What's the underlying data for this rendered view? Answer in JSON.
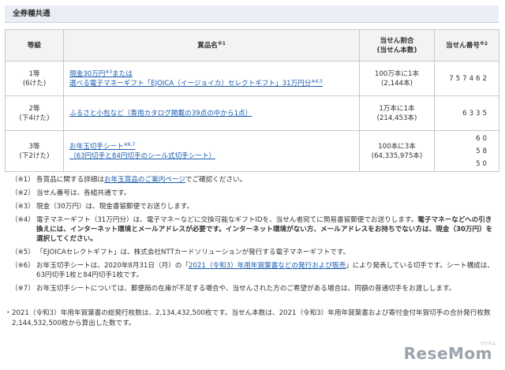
{
  "section_title": "全券種共通",
  "table": {
    "headers": {
      "rank": "等級",
      "prize": "賞品名",
      "prize_note": "※1",
      "odds_line1": "当せん割合",
      "odds_line2": "(当せん本数)",
      "number": "当せん番号",
      "number_note": "※2"
    },
    "rows": [
      {
        "rank": "1等",
        "rank_sub": "(6けた)",
        "prize_a": "現金30万円",
        "prize_a_note": "※3",
        "prize_a_tail": "または",
        "prize_b": "選べる電子マネーギフト「EJOICA（イージョイカ）セレクトギフト」31万円分",
        "prize_b_note": "※4,5",
        "odds": "100万本に1本",
        "odds_count": "(2,144本)",
        "number": "757462"
      },
      {
        "rank": "2等",
        "rank_sub": "(下4けた)",
        "prize_a": "ふるさと小包など（専用カタログ掲載の39点の中から1点）",
        "odds": "1万本に1本",
        "odds_count": "(214,453本)",
        "number": "6335"
      },
      {
        "rank": "3等",
        "rank_sub": "(下2けた)",
        "prize_a": "お年玉切手シート",
        "prize_a_note": "※6,7",
        "prize_b": "（63円切手と84円切手のシール式切手シート）",
        "odds": "100本に3本",
        "odds_count": "(64,335,975本)",
        "numbers": [
          "60",
          "58",
          "50"
        ]
      }
    ]
  },
  "notes": [
    {
      "mark": "（※1）",
      "pre": "各賞品に関する詳細は",
      "link": "お年玉賞品のご案内ページ",
      "post": "でご確認ください。"
    },
    {
      "mark": "（※2）",
      "text": "当せん番号は、各組共通です。"
    },
    {
      "mark": "（※3）",
      "text": "現金（30万円）は、現金書留郵便でお送りします。"
    },
    {
      "mark": "（※4）",
      "text": "電子マネーギフト（31万円分）は、電子マネーなどに交換可能なギフトIDを、当せん者宛てに簡易書留郵便でお送りします。",
      "bold": "電子マネーなどへの引き換えには、インターネット環境とメールアドレスが必要です。インターネット環境がない方、メールアドレスをお持ちでない方は、現金（30万円）を選択してください。"
    },
    {
      "mark": "（※5）",
      "text": "「EJOICAセレクトギフト」は、株式会社NTTカードソリューションが発行する電子マネーギフトです。"
    },
    {
      "mark": "（※6）",
      "pre": "お年玉切手シートは、2020年8月31日（月）の「",
      "link": "2021（令和3）年用年賀葉書などの発行および販売",
      "post": "」により発表している切手です。シート構成は、63円切手1枚と84円切手1枚です。"
    },
    {
      "mark": "（※7）",
      "text": "お年玉切手シートについては、郵便局の在庫が不足する場合や、当せんされた方のご希望がある場合は、同額の普通切手をお渡しします。"
    }
  ],
  "footnote": {
    "mark": "・",
    "text": "2021（令和3）年用年賀葉書の総発行枚数は、2,134,432,500枚です。当せん本数は、2021（令和3）年用年賀葉書および寄付金付年賀切手の合計発行枚数2,144,532,500枚から算出した数です。"
  },
  "logo": "ReseMom",
  "logo_sub": "リセマム"
}
